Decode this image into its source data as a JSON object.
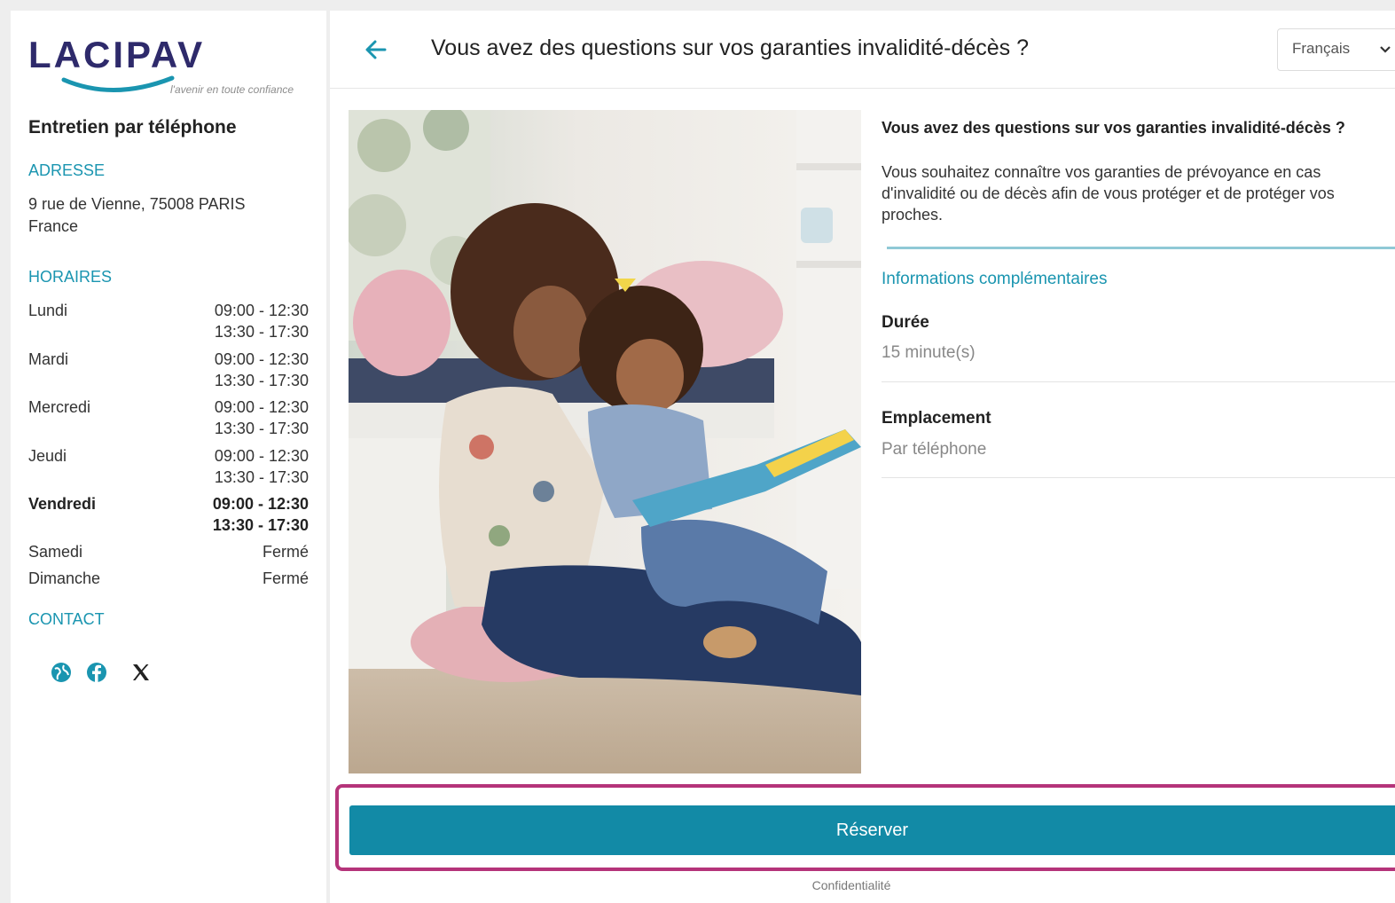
{
  "sidebar": {
    "logo_text": "LACIPAV",
    "logo_tagline": "l'avenir en toute confiance",
    "title": "Entretien par téléphone",
    "address_heading": "ADRESSE",
    "address_line1": "9 rue de Vienne, 75008 PARIS",
    "address_line2": "France",
    "hours_heading": "HORAIRES",
    "hours": [
      {
        "day": "Lundi",
        "slot1": "09:00 - 12:30",
        "slot2": "13:30 - 17:30"
      },
      {
        "day": "Mardi",
        "slot1": "09:00 - 12:30",
        "slot2": "13:30 - 17:30"
      },
      {
        "day": "Mercredi",
        "slot1": "09:00 - 12:30",
        "slot2": "13:30 - 17:30"
      },
      {
        "day": "Jeudi",
        "slot1": "09:00 - 12:30",
        "slot2": "13:30 - 17:30"
      },
      {
        "day": "Vendredi",
        "slot1": "09:00 - 12:30",
        "slot2": "13:30 - 17:30"
      },
      {
        "day": "Samedi",
        "slot1": "Fermé"
      },
      {
        "day": "Dimanche",
        "slot1": "Fermé"
      }
    ],
    "contact_heading": "CONTACT",
    "social_icons": [
      "globe-icon",
      "facebook-icon",
      "x-icon"
    ]
  },
  "header": {
    "title": "Vous avez des questions sur vos garanties invalidité-décès ?",
    "language": "Français"
  },
  "details": {
    "title": "Vous avez des questions sur vos garanties invalidité-décès ?",
    "description": "Vous souhaitez connaître vos garanties de prévoyance en cas d'invalidité ou de décès afin de vous protéger et de protéger vos proches.",
    "info_heading": "Informations complémentaires",
    "duration_label": "Durée",
    "duration_value": "15 minute(s)",
    "location_label": "Emplacement",
    "location_value": "Par téléphone"
  },
  "actions": {
    "reserve_label": "Réserver",
    "privacy_label": "Confidentialité"
  },
  "colors": {
    "accent": "#1a95b0",
    "button": "#128aa6",
    "highlight_frame": "#b5347a",
    "logo_dark": "#2e2a6b"
  }
}
